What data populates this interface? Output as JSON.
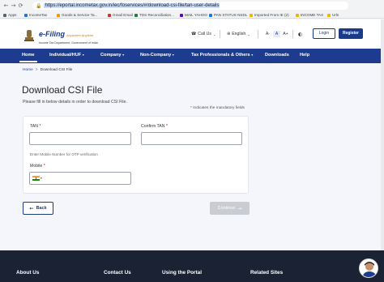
{
  "browser": {
    "url": "https://eportal.incometax.gov.in/iec/foservices/#/download-csi-file/tan-user-details",
    "bookmarks": [
      "Apps",
      "IncomeTax",
      "Goods & Service Ta...",
      "Gmail Email",
      "TDS Reconciliation...",
      "MAIL YAHOO",
      "PAN STATUS NSDL",
      "Imported From IE (2)",
      "INCOME TAX",
      "Urls"
    ]
  },
  "header": {
    "logo_title": "e-Filing",
    "logo_tagline": "Anywhere Anytime",
    "logo_sub": "Income Tax Department, Government of India",
    "call_us": "Call Us",
    "language": "English",
    "font_minus": "A-",
    "font_normal": "A",
    "font_plus": "A+",
    "login": "Login",
    "register": "Register"
  },
  "nav": {
    "items": [
      "Home",
      "Individual/HUF",
      "Company",
      "Non-Company",
      "Tax Professionals & Others",
      "Downloads",
      "Help"
    ]
  },
  "breadcrumb": {
    "home": "Home",
    "separator": ">",
    "current": "Download CSI File"
  },
  "page": {
    "title": "Download CSI File",
    "subtitle": "Please fill in below details in order to download CSI File.",
    "mandatory_note": "* Indicates the mandatory fields"
  },
  "form": {
    "tan_label": "TAN",
    "tan_value": "",
    "confirm_tan_label": "Confirm TAN",
    "confirm_tan_value": "",
    "required_mark": "*",
    "otp_hint": "Enter Mobile Number for OTP verification",
    "mobile_label": "Mobile",
    "mobile_value": ""
  },
  "buttons": {
    "back": "Back",
    "continue": "Continue"
  },
  "footer": {
    "columns": [
      "About Us",
      "Contact Us",
      "Using the Portal",
      "Related Sites"
    ]
  },
  "colors": {
    "brand": "#1d3c8f",
    "footer": "#1b2233",
    "disabled": "#c9ccd3"
  }
}
